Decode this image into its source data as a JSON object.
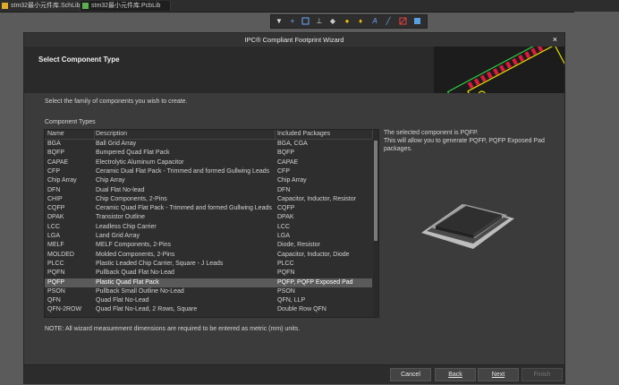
{
  "tabs": [
    {
      "label": "stm32最小元件库.SchLib"
    },
    {
      "label": "stm32最小元件库.PcbLib"
    }
  ],
  "toolbar_icons": [
    "filter-icon",
    "cross-icon",
    "rect-select-icon",
    "pad-icon",
    "via-icon",
    "circle-icon",
    "place-icon",
    "text-icon",
    "line-icon",
    "component-icon",
    "region-icon"
  ],
  "dialog": {
    "title": "IPC® Compliant Footprint Wizard",
    "close": "×",
    "header_title": "Select Component Type",
    "instruction": "Select the family of components you wish to create.",
    "table_label": "Component Types",
    "columns": [
      "Name",
      "Description",
      "Included Packages"
    ],
    "rows": [
      {
        "name": "BGA",
        "desc": "Ball Grid Array",
        "pkg": "BGA, CGA"
      },
      {
        "name": "BQFP",
        "desc": "Bumpered Quad Flat Pack",
        "pkg": "BQFP"
      },
      {
        "name": "CAPAE",
        "desc": "Electrolytic Aluminum Capacitor",
        "pkg": "CAPAE"
      },
      {
        "name": "CFP",
        "desc": "Ceramic Dual Flat Pack - Trimmed and formed Gullwing Leads",
        "pkg": "CFP"
      },
      {
        "name": "Chip Array",
        "desc": "Chip Array",
        "pkg": "Chip Array"
      },
      {
        "name": "DFN",
        "desc": "Dual Flat No-lead",
        "pkg": "DFN"
      },
      {
        "name": "CHIP",
        "desc": "Chip Components, 2-Pins",
        "pkg": "Capacitor, Inductor, Resistor"
      },
      {
        "name": "CQFP",
        "desc": "Ceramic Quad Flat Pack - Trimmed and formed Gullwing Leads",
        "pkg": "CQFP"
      },
      {
        "name": "DPAK",
        "desc": "Transistor Outline",
        "pkg": "DPAK"
      },
      {
        "name": "LCC",
        "desc": "Leadless Chip Carrier",
        "pkg": "LCC"
      },
      {
        "name": "LGA",
        "desc": "Land Grid Array",
        "pkg": "LGA"
      },
      {
        "name": "MELF",
        "desc": "MELF Components, 2-Pins",
        "pkg": "Diode, Resistor"
      },
      {
        "name": "MOLDED",
        "desc": "Molded Components, 2-Pins",
        "pkg": "Capacitor, Inductor, Diode"
      },
      {
        "name": "PLCC",
        "desc": "Plastic Leaded Chip Carrier, Square - J Leads",
        "pkg": "PLCC"
      },
      {
        "name": "PQFN",
        "desc": "Pullback Quad Flat No-Lead",
        "pkg": "PQFN"
      },
      {
        "name": "PQFP",
        "desc": "Plastic Quad Flat Pack",
        "pkg": "PQFP, PQFP Exposed Pad",
        "selected": true
      },
      {
        "name": "PSON",
        "desc": "Pullback Small Outline No-Lead",
        "pkg": "PSON"
      },
      {
        "name": "QFN",
        "desc": "Quad Flat No-Lead",
        "pkg": "QFN, LLP"
      },
      {
        "name": "QFN-2ROW",
        "desc": "Quad Flat No-Lead, 2 Rows, Square",
        "pkg": "Double Row QFN"
      }
    ],
    "description_lines": [
      "The selected component is PQFP.",
      "This will allow you to generate PQFP, PQFP Exposed Pad",
      "packages."
    ],
    "note": "NOTE: All wizard measurement dimensions are required to be entered as metric (mm) units.",
    "buttons": {
      "cancel": "Cancel",
      "back": "Back",
      "next": "Next",
      "finish": "Finish"
    },
    "colors": {
      "selected_row": "#5a5a5a",
      "pcb_pad": "#e0193a",
      "pcb_outline": "#e8e000",
      "pcb_edge": "#2ecc40"
    }
  }
}
